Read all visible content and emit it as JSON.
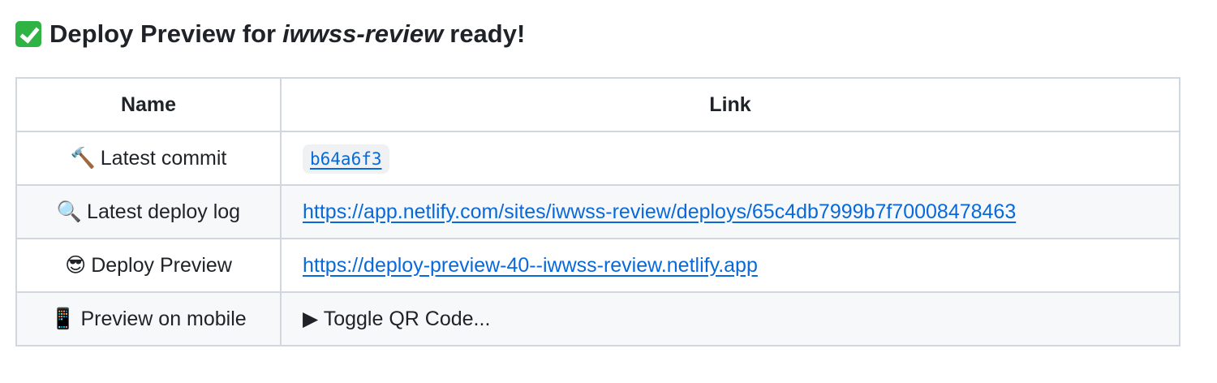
{
  "heading": {
    "prefix": "Deploy Preview for",
    "site": "iwwss-review",
    "suffix": "ready!",
    "icon": "check-mark-button-icon"
  },
  "table": {
    "headers": [
      "Name",
      "Link"
    ],
    "rows": [
      {
        "icon": "🔨",
        "icon_name": "hammer-icon",
        "name": "Latest commit",
        "link": "b64a6f3",
        "type": "code"
      },
      {
        "icon": "🔍",
        "icon_name": "magnifying-glass-icon",
        "name": "Latest deploy log",
        "link": "https://app.netlify.com/sites/iwwss-review/deploys/65c4db7999b7f70008478463",
        "type": "link"
      },
      {
        "icon": "😎",
        "icon_name": "sunglasses-face-icon",
        "name": "Deploy Preview",
        "link": "https://deploy-preview-40--iwwss-review.netlify.app",
        "type": "link"
      },
      {
        "icon": "📱",
        "icon_name": "mobile-phone-icon",
        "name": "Preview on mobile",
        "link": "▶ Toggle QR Code...",
        "type": "toggle"
      }
    ]
  },
  "colors": {
    "link": "#0969da",
    "border": "#d0d7de",
    "alt_row": "#f6f8fa",
    "check": "#2fb344"
  }
}
